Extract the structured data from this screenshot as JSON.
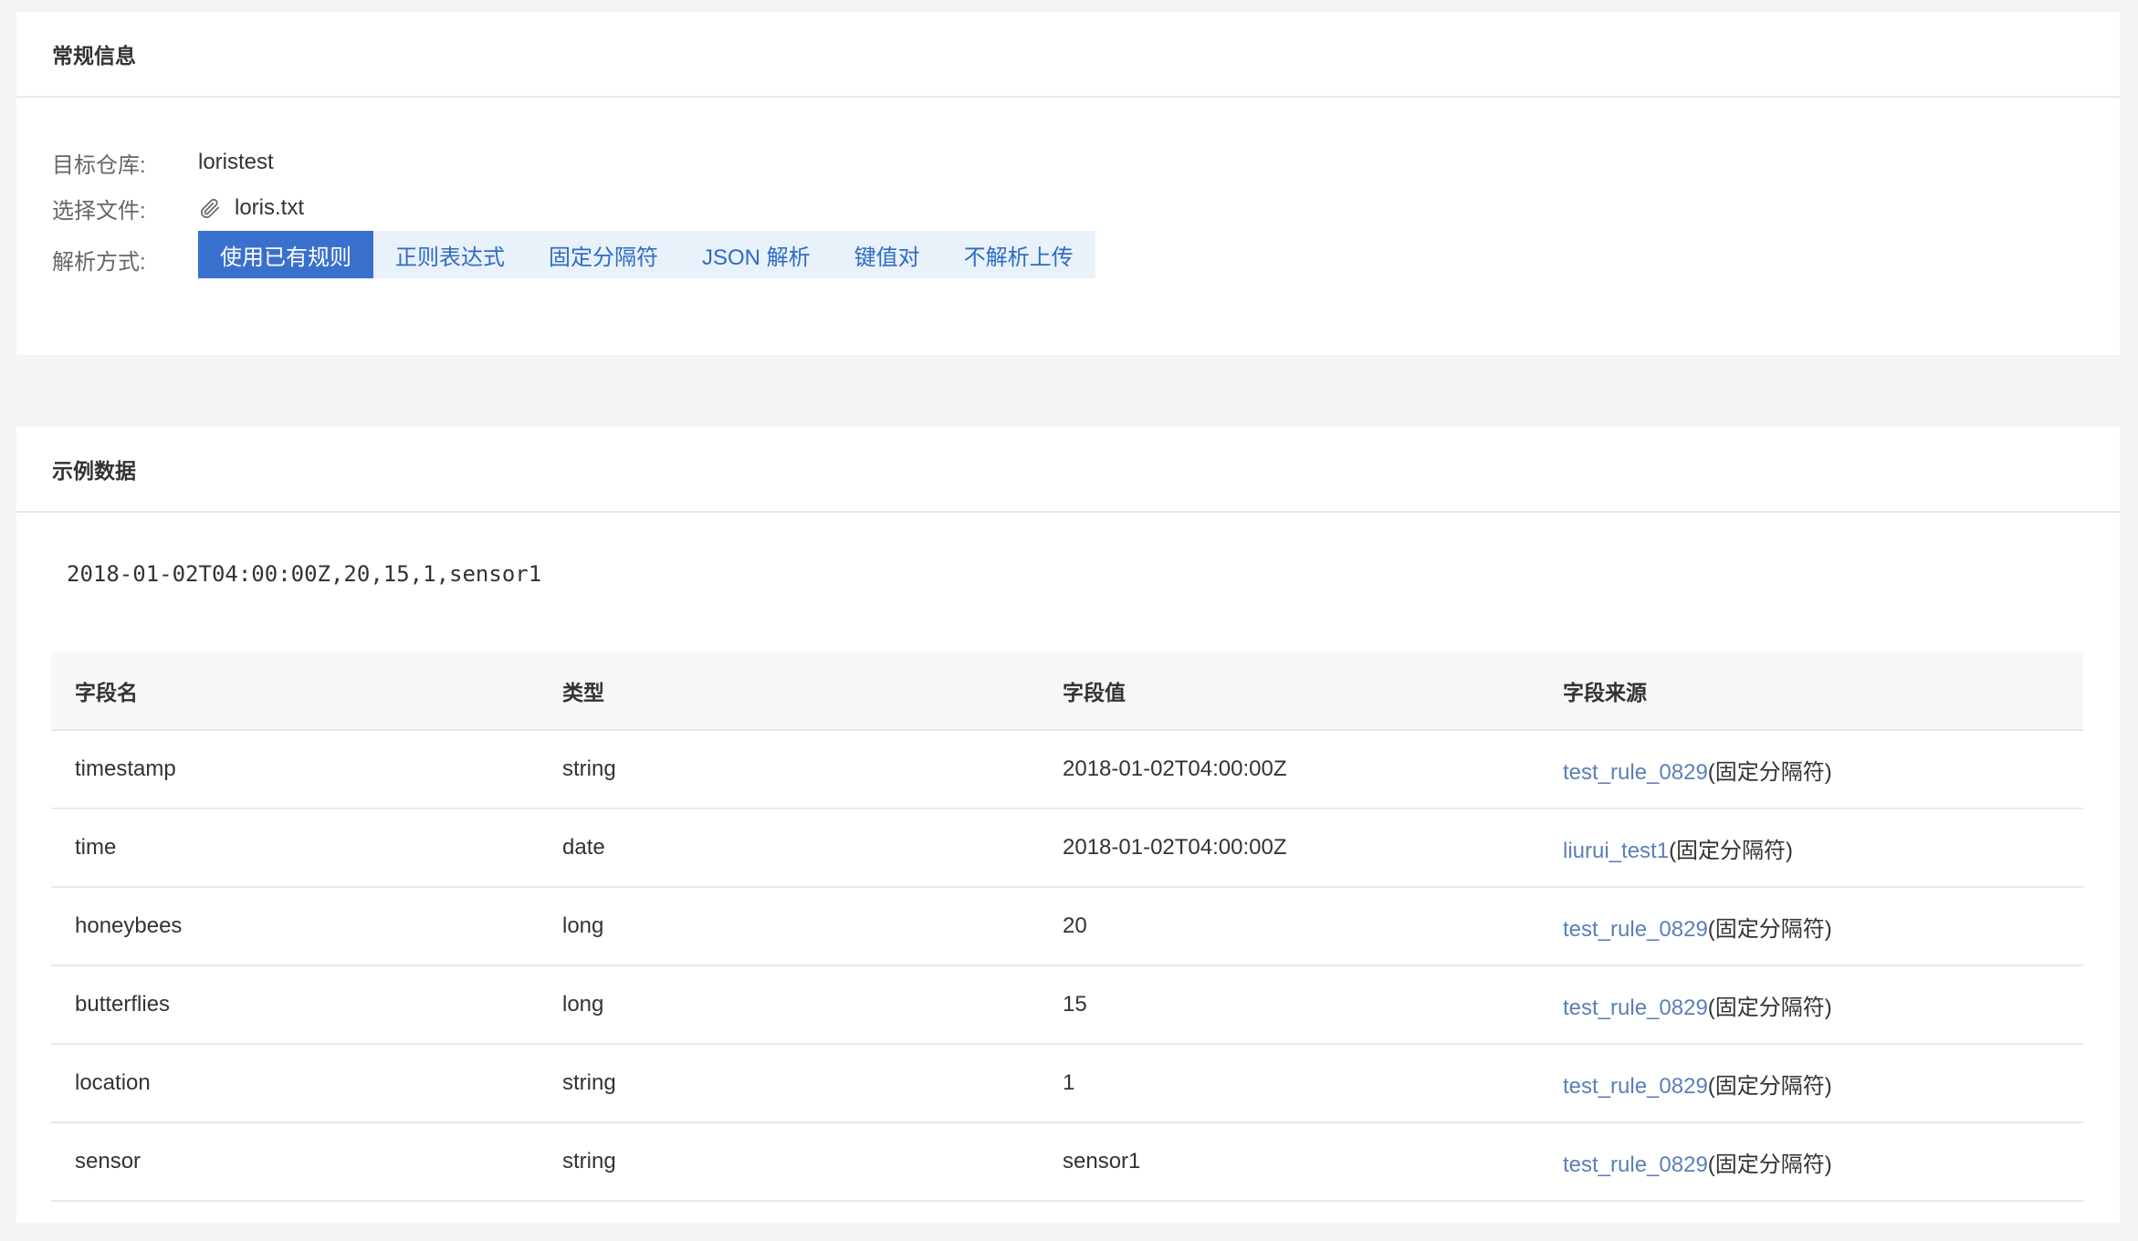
{
  "general": {
    "title": "常规信息",
    "repo_label": "目标仓库:",
    "repo_value": "loristest",
    "file_label": "选择文件:",
    "file_value": "loris.txt",
    "file_icon": "paperclip-icon",
    "parse_label": "解析方式:",
    "parse_options": [
      {
        "label": "使用已有规则",
        "active": true
      },
      {
        "label": "正则表达式",
        "active": false
      },
      {
        "label": "固定分隔符",
        "active": false
      },
      {
        "label": "JSON 解析",
        "active": false
      },
      {
        "label": "键值对",
        "active": false
      },
      {
        "label": "不解析上传",
        "active": false
      }
    ]
  },
  "sample": {
    "title": "示例数据",
    "raw": "2018-01-02T04:00:00Z,20,15,1,sensor1",
    "columns": [
      "字段名",
      "类型",
      "字段值",
      "字段来源"
    ],
    "rows": [
      {
        "name": "timestamp",
        "type": "string",
        "value": "2018-01-02T04:00:00Z",
        "source_link": "test_rule_0829",
        "source_suffix": "(固定分隔符)"
      },
      {
        "name": "time",
        "type": "date",
        "value": "2018-01-02T04:00:00Z",
        "source_link": "liurui_test1",
        "source_suffix": "(固定分隔符)"
      },
      {
        "name": "honeybees",
        "type": "long",
        "value": "20",
        "source_link": "test_rule_0829",
        "source_suffix": "(固定分隔符)"
      },
      {
        "name": "butterflies",
        "type": "long",
        "value": "15",
        "source_link": "test_rule_0829",
        "source_suffix": "(固定分隔符)"
      },
      {
        "name": "location",
        "type": "string",
        "value": "1",
        "source_link": "test_rule_0829",
        "source_suffix": "(固定分隔符)"
      },
      {
        "name": "sensor",
        "type": "string",
        "value": "sensor1",
        "source_link": "test_rule_0829",
        "source_suffix": "(固定分隔符)"
      }
    ]
  },
  "colors": {
    "accent": "#3a70cd",
    "accent_light": "#e9f1fb",
    "link": "#5a7fb8",
    "page_bg": "#f3f4f6"
  }
}
